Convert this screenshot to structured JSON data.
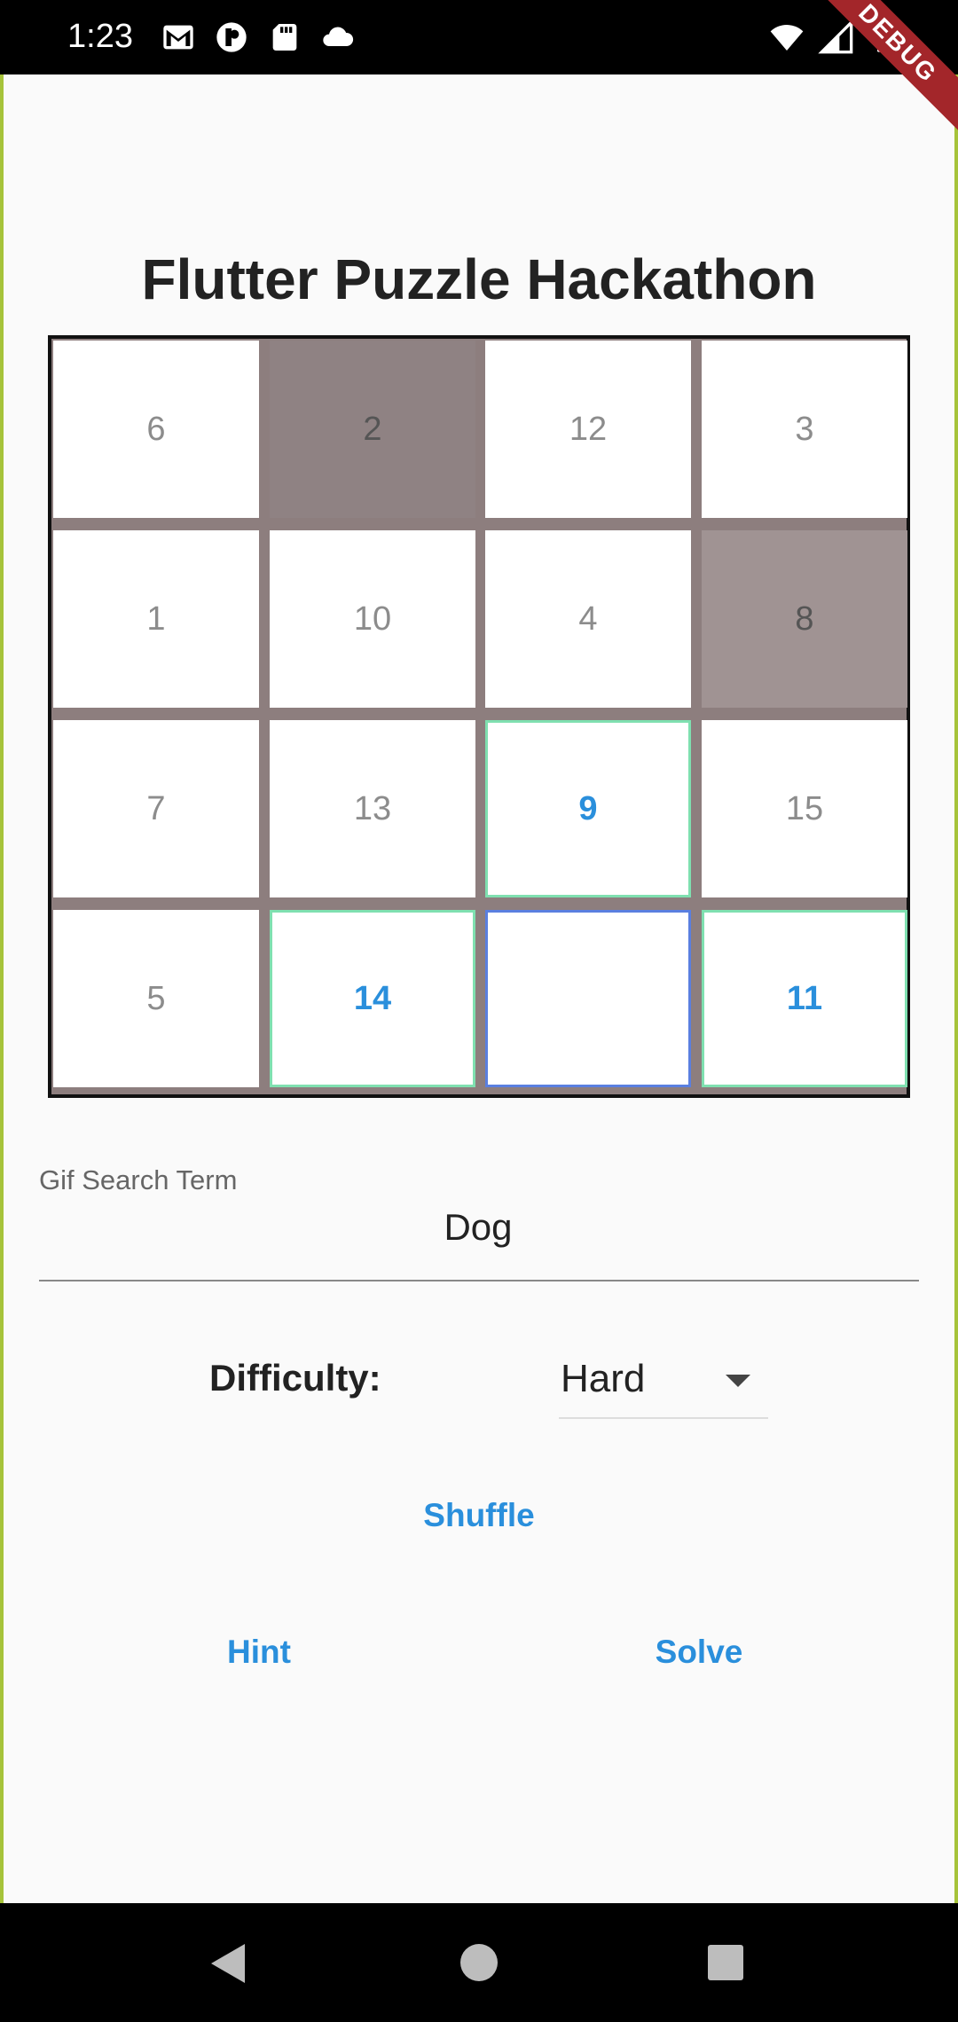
{
  "status_bar": {
    "time": "1:23",
    "left_icons": [
      "gmail-icon",
      "app-icon",
      "sd-card-icon",
      "cloud-icon"
    ],
    "right_icons": [
      "wifi-icon",
      "signal-icon",
      "battery-icon"
    ],
    "debug_banner": "DEBUG"
  },
  "app": {
    "title": "Flutter Puzzle Hackathon"
  },
  "puzzle": {
    "tiles": [
      [
        "6",
        "2",
        "12",
        "3"
      ],
      [
        "1",
        "10",
        "4",
        "8"
      ],
      [
        "7",
        "13",
        "9",
        "15"
      ],
      [
        "5",
        "14",
        "",
        "11"
      ]
    ],
    "movable": [
      "9",
      "14",
      "11"
    ],
    "image_tiles": [
      "2",
      "8"
    ]
  },
  "search": {
    "label": "Gif Search Term",
    "value": "Dog"
  },
  "difficulty": {
    "label": "Difficulty:",
    "selected": "Hard"
  },
  "buttons": {
    "shuffle": "Shuffle",
    "hint": "Hint",
    "solve": "Solve"
  },
  "colors": {
    "accent": "#2a8fdc",
    "movable_border": "#7fe0b0",
    "empty_border": "#5a7fe0",
    "debug_banner": "#a3262a"
  }
}
